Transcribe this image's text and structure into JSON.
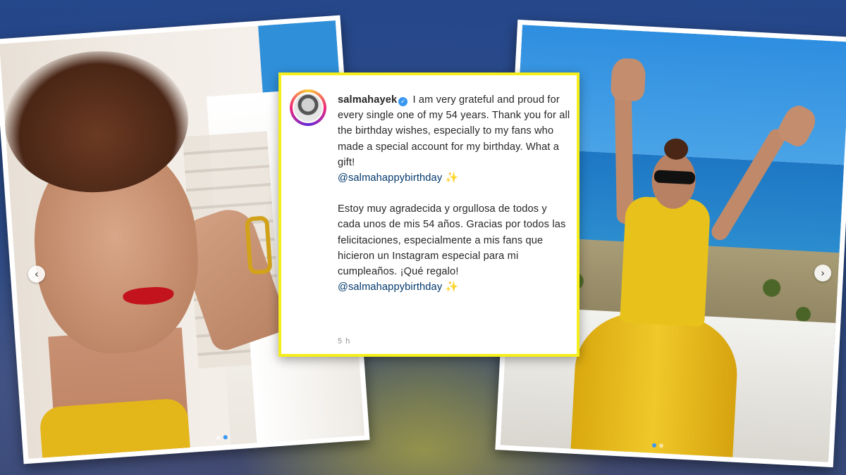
{
  "post": {
    "username": "salmahayek",
    "verified_icon": "verified-badge-icon",
    "caption_en": "I am very grateful and proud for every single one of my 54 years. Thank you for all the birthday wishes, especially to my fans who made a special account for my birthday. What a gift!",
    "mention_en": "@salmahappybirthday",
    "caption_es": "Estoy muy agradecida y orgullosa de todos y cada unos de mis 54 años. Gracias por todos las felicitaciones, especialmente a mis fans que hicieron un Instagram especial para mi cumpleaños. ¡Qué regalo!",
    "mention_es": "@salmahappybirthday",
    "sparkle": "✨",
    "timestamp": "5 h"
  },
  "carousel": {
    "left_arrow": "‹",
    "right_arrow": "›"
  },
  "colors": {
    "caption_border": "#f5ee1a",
    "mention": "#00376b",
    "verified": "#3897f0"
  }
}
